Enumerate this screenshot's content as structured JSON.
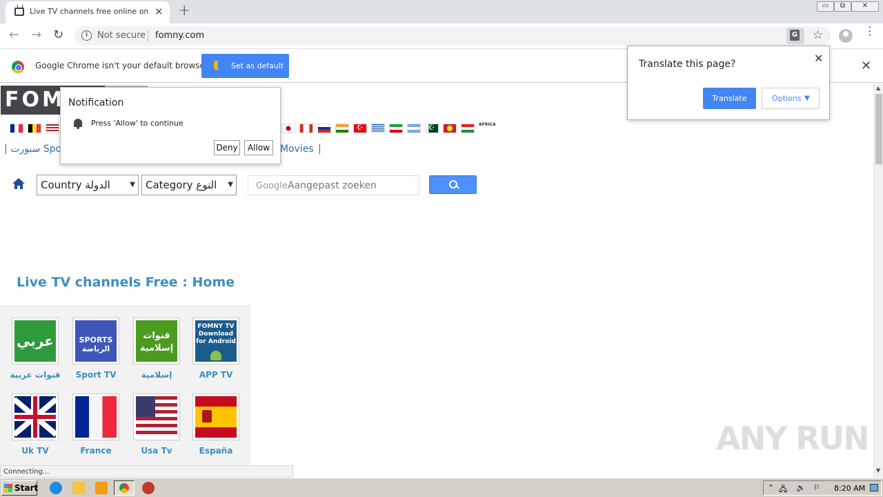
{
  "browser": {
    "tab_title": "Live TV channels free online on Inter",
    "tab_close": "✕",
    "new_tab": "+",
    "window_controls": [
      "▭",
      "⧉",
      "✕"
    ],
    "nav": {
      "back": "←",
      "forward": "→",
      "reload": "↻"
    },
    "security_label": "Not secure",
    "url": "fomny.com",
    "bookmark_star": "☆",
    "menu": "⋮"
  },
  "infobar": {
    "message": "Google Chrome isn't your default browser",
    "button": "Set as default",
    "close": "✕"
  },
  "translate": {
    "prompt": "Translate this page?",
    "close": "✕",
    "translate_button": "Translate",
    "options_button": "Options",
    "options_caret": "▼"
  },
  "notification": {
    "title": "Notification",
    "message": "Press 'Allow' to continue",
    "deny": "Deny",
    "allow": "Allow"
  },
  "site": {
    "logo": "FOM",
    "africa_label": "AFRICA",
    "nav_left": "|  سبورت Spo",
    "nav_movies": "Movies",
    "nav_sep": "|",
    "country_select": "Country الدولة",
    "category_select": "Category النوع",
    "select_caret": "▼",
    "search_brand": "Google",
    "search_placeholder": "Aangepast zoeken",
    "page_title": "Live TV channels Free : Home",
    "tiles": [
      {
        "label": "قنوات عربية",
        "art": "عربي"
      },
      {
        "label": "Sport TV",
        "art": "SPORTS الرياضة"
      },
      {
        "label": "إسلامية",
        "art": "قنوات إسلامية"
      },
      {
        "label": "APP TV",
        "art": "FOMNY TV Download for Android"
      },
      {
        "label": "Uk TV",
        "art": ""
      },
      {
        "label": "France",
        "art": ""
      },
      {
        "label": "Usa Tv",
        "art": ""
      },
      {
        "label": "España",
        "art": ""
      }
    ],
    "flag_colors": [
      "#002395",
      "#fdda24",
      "#b22234",
      "#ffffff",
      "#d52b1e",
      "#d52b1e",
      "#ffffff",
      "#ff9933",
      "#e30a17",
      "#0d5eaf",
      "#239f40",
      "#74acdf",
      "#01411c",
      "#ce2028",
      "#d90012"
    ]
  },
  "status": "Connecting...",
  "watermark": "ANY RUN",
  "taskbar": {
    "start": "Start",
    "clock": "8:20 AM"
  }
}
